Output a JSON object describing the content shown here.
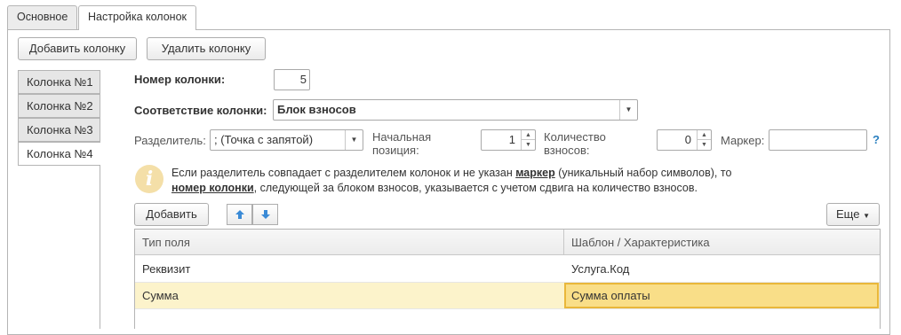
{
  "tabs": [
    "Основное",
    "Настройка колонок"
  ],
  "toolbar": {
    "add_column": "Добавить колонку",
    "delete_column": "Удалить колонку"
  },
  "column_tabs": [
    "Колонка №1",
    "Колонка №2",
    "Колонка №3",
    "Колонка №4"
  ],
  "form": {
    "column_number_label": "Номер колонки:",
    "column_number_value": "5",
    "mapping_label": "Соответствие колонки:",
    "mapping_value": "Блок взносов",
    "separator_label": "Разделитель:",
    "separator_value": "; (Точка с запятой)",
    "start_pos_label_1": "Начальная",
    "start_pos_label_2": "позиция:",
    "start_pos_value": "1",
    "count_label_1": "Количество",
    "count_label_2": "взносов:",
    "count_value": "0",
    "marker_label": "Маркер:",
    "marker_value": "",
    "help": "?"
  },
  "info": {
    "line1_a": "Если разделитель совпадает с разделителем колонок и не указан ",
    "line1_bold": "маркер",
    "line1_b": " (уникальный набор символов), то",
    "line2_bold": "номер колонки",
    "line2_b": ", следующей за блоком взносов, указывается с учетом сдвига на количество взносов."
  },
  "table_toolbar": {
    "add": "Добавить",
    "more": "Еще"
  },
  "table": {
    "headers": [
      "Тип поля",
      "Шаблон / Характеристика"
    ],
    "rows": [
      [
        "Реквизит",
        "Услуга.Код"
      ],
      [
        "Сумма",
        "Сумма оплаты"
      ]
    ]
  },
  "icons": {
    "info": "info-icon",
    "up": "arrow-up-icon",
    "down": "arrow-down-icon",
    "dropdown": "chevron-down-icon"
  },
  "colors": {
    "accent_blue": "#2a7fbf",
    "selected_row": "#fcf3cb",
    "selected_cell": "#f9de88",
    "info_icon": "#f4dfa8"
  }
}
